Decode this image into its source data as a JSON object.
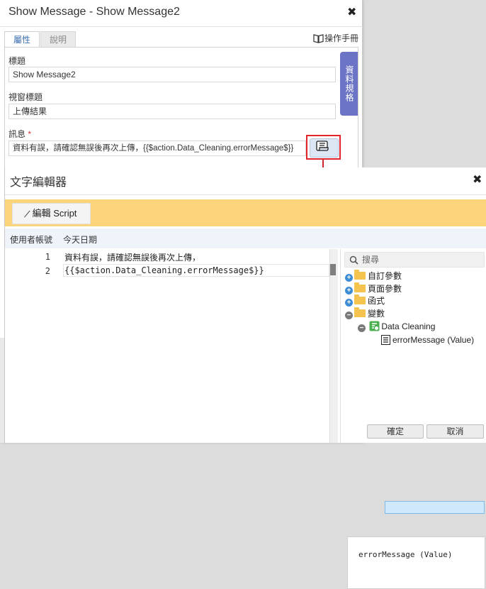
{
  "properties_dialog": {
    "title": "Show Message - Show Message2",
    "close": "✖",
    "tabs": [
      "屬性",
      "說明"
    ],
    "manual_link": "操作手冊",
    "side_tab": "資料規格",
    "fields": {
      "title_label": "標題",
      "title_value": "Show Message2",
      "window_title_label": "視窗標題",
      "window_title_value": "上傳結果",
      "message_label": "訊息",
      "required_mark": "*",
      "message_value": "資料有誤，請確認無誤後再次上傳，{{$action.Data_Cleaning.errorMessage$}}"
    }
  },
  "text_editor": {
    "title": "文字編輯器",
    "close": "✖",
    "edit_script_label": "編輯 Script",
    "quick_insert": [
      "使用者帳號",
      "今天日期"
    ],
    "lines": [
      {
        "no": "1",
        "text": "資料有誤，請確認無誤後再次上傳，"
      },
      {
        "no": "2",
        "text": "{{$action.Data_Cleaning.errorMessage$}}"
      }
    ],
    "search_placeholder": "搜尋",
    "tree": {
      "custom_params": "自訂參數",
      "page_params": "頁面參數",
      "functions": "函式",
      "variables": "變數",
      "data_cleaning": "Data Cleaning",
      "error_message": "errorMessage (Value)"
    },
    "detail_text": "errorMessage (Value)",
    "ok_label": "確定",
    "cancel_label": "取消"
  },
  "colors": {
    "toolbar": "#fcd47c",
    "side_tab": "#6c74c6",
    "highlight_border": "#e0262b",
    "arrow": "#d2262b",
    "selection": "#cfe8fb"
  }
}
